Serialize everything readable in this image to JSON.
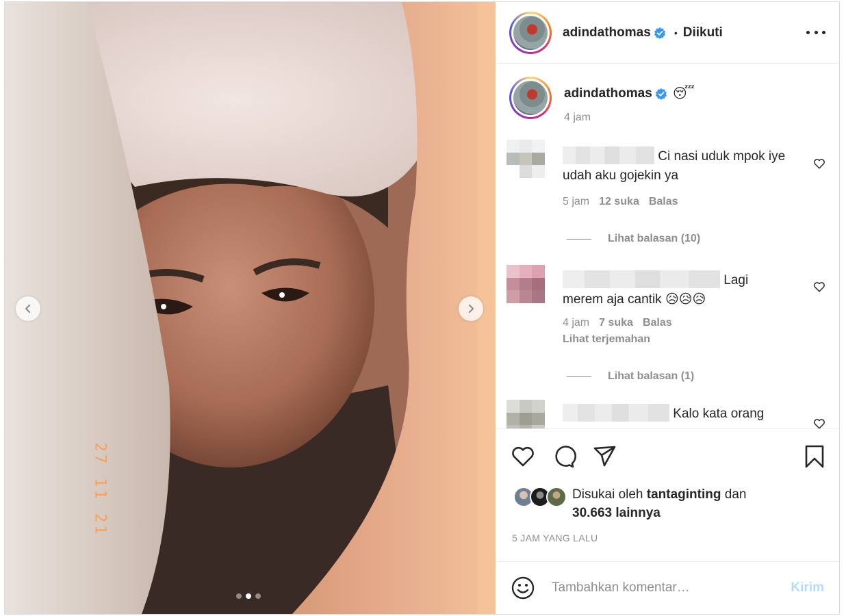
{
  "post": {
    "username": "adindathomas",
    "separator": "•",
    "follow_state": "Diikuti",
    "caption_emoji": "😴",
    "caption_time": "4 jam",
    "photo_date_stamp": "27 11 21",
    "carousel": {
      "total": 3,
      "active": 2
    }
  },
  "comments": [
    {
      "text": "Ci nasi uduk mpok iye udah aku gojekin ya",
      "time": "5 jam",
      "likes": "12 suka",
      "reply": "Balas",
      "view_replies": "Lihat balasan (10)"
    },
    {
      "text": "Lagi merem aja cantik 😥😥😥",
      "time": "4 jam",
      "likes": "7 suka",
      "reply": "Balas",
      "translate": "Lihat terjemahan",
      "view_replies": "Lihat balasan (1)"
    },
    {
      "text": "Kalo kata orang"
    }
  ],
  "likes": {
    "prefix": "Disukai oleh",
    "user": "tantaginting",
    "conj": "dan",
    "count_text": "30.663 lainnya"
  },
  "timestamp": "5 JAM YANG LALU",
  "add_comment": {
    "placeholder": "Tambahkan komentar…",
    "post_label": "Kirim"
  },
  "colors": {
    "verified": "#3897f0",
    "post_button_disabled": "#b3dbff",
    "muted_text": "#8e8e8e"
  },
  "icons": [
    "chevron-left-icon",
    "chevron-right-icon",
    "more-icon",
    "verified-icon",
    "heart-icon",
    "comment-icon",
    "share-icon",
    "bookmark-icon",
    "emoji-icon"
  ]
}
